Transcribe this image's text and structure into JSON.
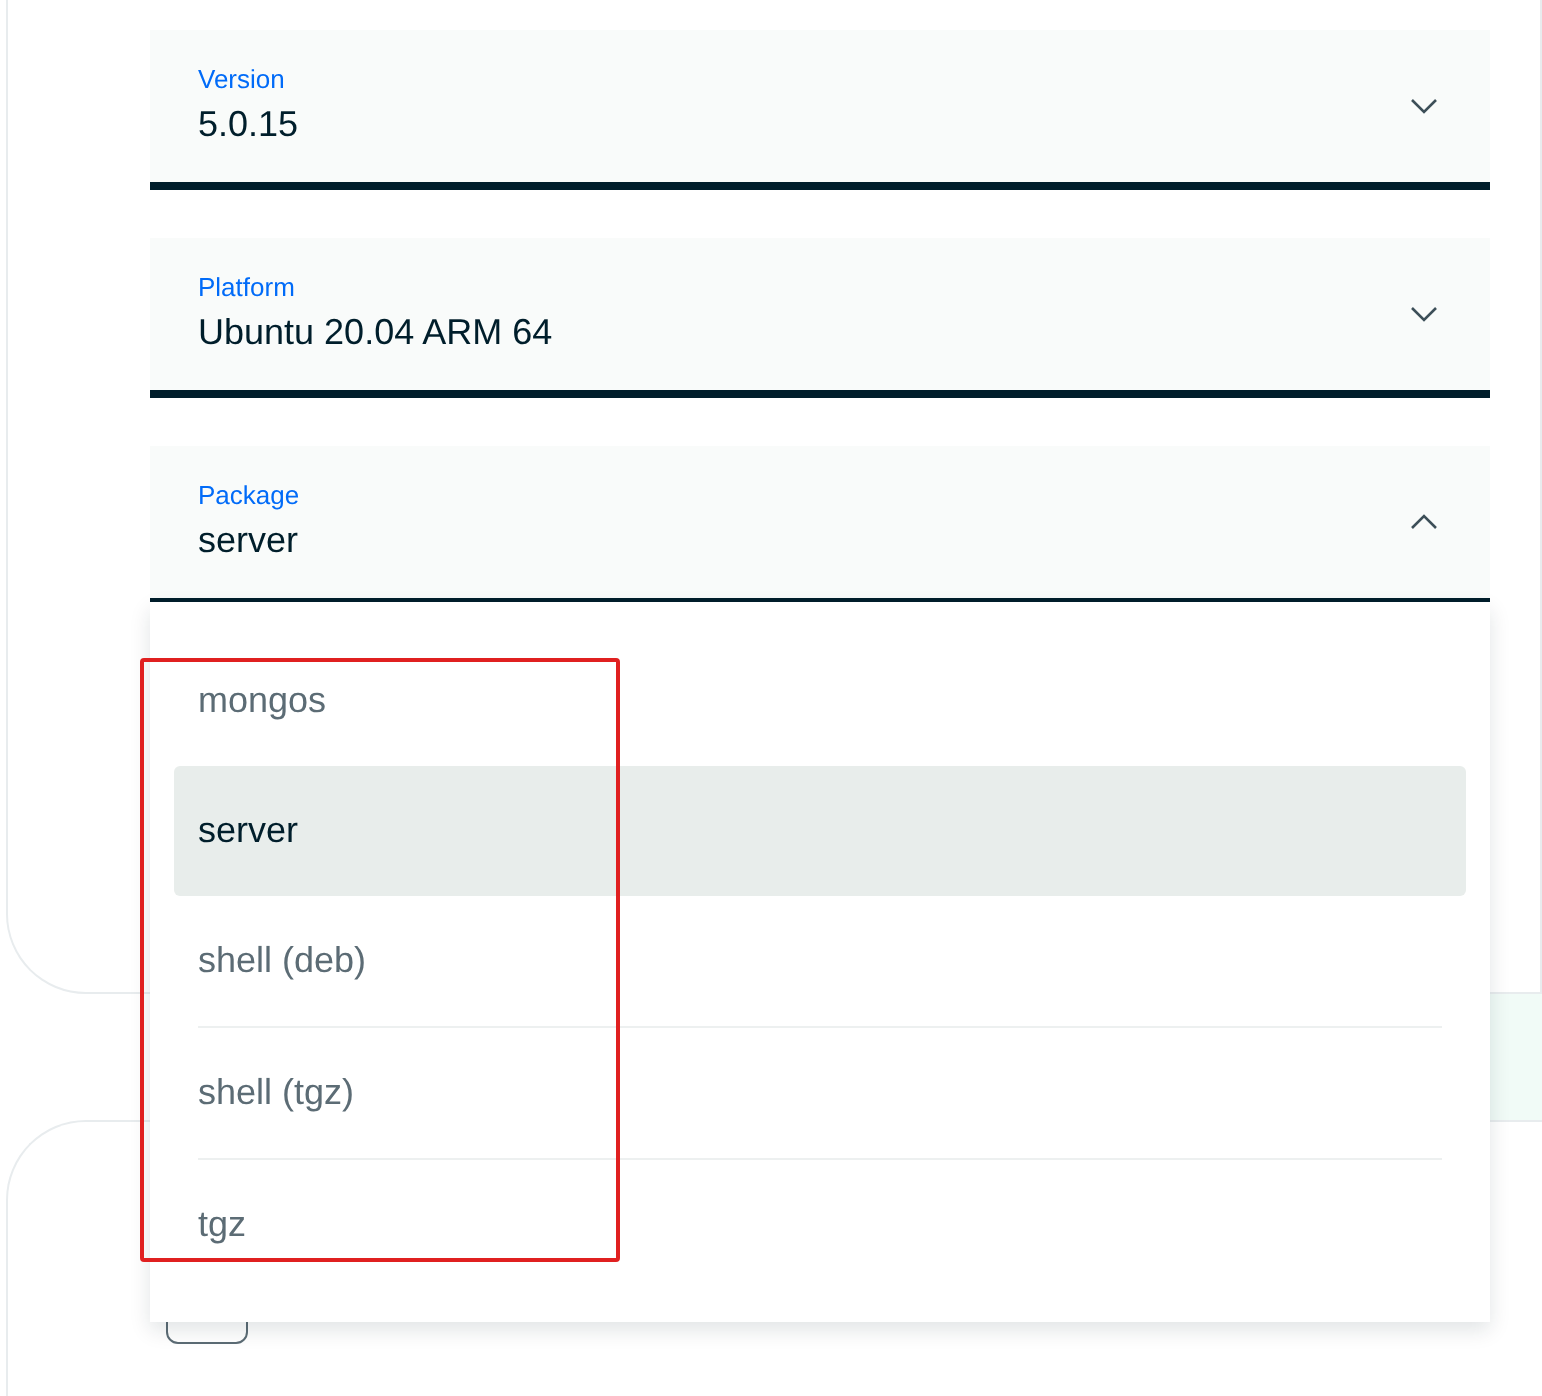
{
  "fields": [
    {
      "label": "Version",
      "value": "5.0.15",
      "expanded": false
    },
    {
      "label": "Platform",
      "value": "Ubuntu 20.04 ARM 64",
      "expanded": false
    },
    {
      "label": "Package",
      "value": "server",
      "expanded": true
    }
  ],
  "package_options": [
    {
      "label": "mongos",
      "selected": false
    },
    {
      "label": "server",
      "selected": true
    },
    {
      "label": "shell (deb)",
      "selected": false
    },
    {
      "label": "shell (tgz)",
      "selected": false
    },
    {
      "label": "tgz",
      "selected": false
    }
  ]
}
